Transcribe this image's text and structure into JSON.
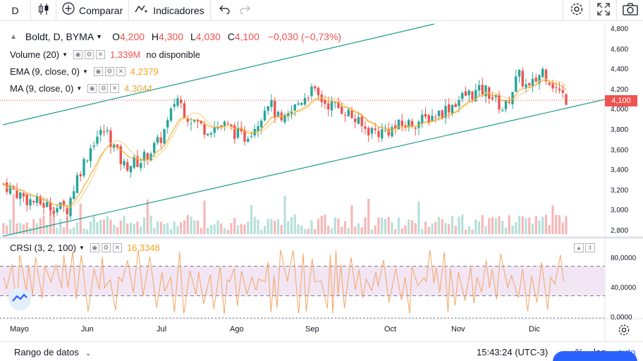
{
  "toolbar": {
    "interval": "D",
    "compare_label": "Comparar",
    "indicators_label": "Indicadores"
  },
  "legend": {
    "symbol": "Boldt, D, BYMA",
    "o_label": "O",
    "o_value": "4,200",
    "h_label": "H",
    "h_value": "4,300",
    "l_label": "L",
    "l_value": "4,030",
    "c_label": "C",
    "c_value": "4,100",
    "change": "−0,030 (−0,73%)",
    "volume_label": "Volume (20)",
    "volume_value": "1,339M",
    "volume_extra": "no disponible",
    "ema_label": "EMA (9, close, 0)",
    "ema_value": "4,2379",
    "ma_label": "MA (9, close, 0)",
    "ma_value": "4,3044",
    "crsi_label": "CRSI (3, 2, 100)",
    "crsi_value": "16,3348"
  },
  "price_axis": [
    "4,800",
    "4,600",
    "4,400",
    "4,200",
    "4,000",
    "3,800",
    "3,600",
    "3,400",
    "3,200",
    "3,000",
    "2,800"
  ],
  "last_price_tag": "4,100",
  "crsi_axis": [
    "80,0000",
    "40,0000",
    "0,0000"
  ],
  "time_axis": [
    "Mayo",
    "Jun",
    "Jul",
    "Ago",
    "Sep",
    "Oct",
    "Nov",
    "Dic"
  ],
  "bottom": {
    "date_range": "Rango de datos",
    "clock": "15:43:24 (UTC-3)",
    "percent": "%",
    "log": "log",
    "auto": "auto"
  },
  "colors": {
    "up": "#26a69a",
    "down": "#ef5350",
    "ema": "#f7a21b",
    "ma": "#f7cf7a",
    "crsi": "#f4a460",
    "channel": "#1e9c8c",
    "crsi_band": "#f2e6f5"
  }
}
